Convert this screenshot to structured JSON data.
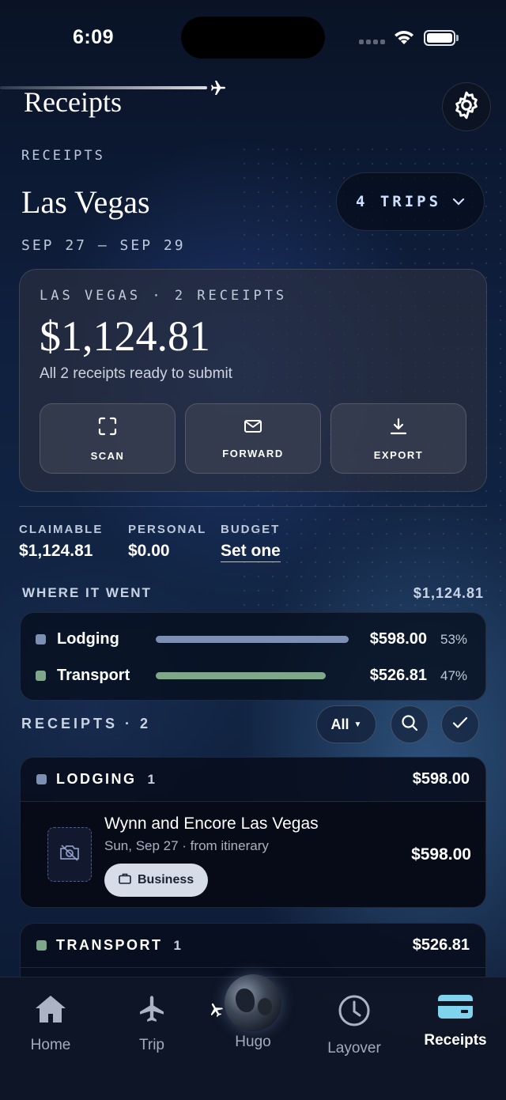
{
  "status_bar": {
    "time": "6:09"
  },
  "header": {
    "title": "Receipts"
  },
  "trip": {
    "section_label": "RECEIPTS",
    "name": "Las Vegas",
    "dates": "SEP 27 — SEP 29",
    "trips_selector": "4 TRIPS"
  },
  "summary": {
    "eyebrow": "LAS VEGAS · 2 RECEIPTS",
    "amount": "$1,124.81",
    "subtitle": "All 2 receipts ready to submit",
    "actions": [
      {
        "label": "SCAN",
        "icon": "scan-icon"
      },
      {
        "label": "FORWARD",
        "icon": "mail-icon"
      },
      {
        "label": "EXPORT",
        "icon": "download-icon"
      }
    ]
  },
  "stats": [
    {
      "label": "CLAIMABLE",
      "value": "$1,124.81"
    },
    {
      "label": "PERSONAL",
      "value": "$0.00"
    },
    {
      "label": "BUDGET",
      "value": "Set one"
    }
  ],
  "breakdown": {
    "label": "WHERE IT WENT",
    "total": "$1,124.81",
    "categories": [
      {
        "name": "Lodging",
        "amount": "$598.00",
        "percent_label": "53%",
        "share": 1.0,
        "color": "#7d8fb3"
      },
      {
        "name": "Transport",
        "amount": "$526.81",
        "percent_label": "47%",
        "share": 0.88,
        "color": "#7fa88a"
      }
    ]
  },
  "receipts_section": {
    "label": "RECEIPTS · 2",
    "filter": "All",
    "groups": [
      {
        "name": "LODGING",
        "count": "1",
        "total": "$598.00",
        "color": "#7d8fb3",
        "items": [
          {
            "title": "Wynn and Encore Las Vegas",
            "meta": "Sun, Sep 27 · from itinerary",
            "tag": "Business",
            "amount": "$598.00"
          }
        ]
      },
      {
        "name": "TRANSPORT",
        "count": "1",
        "total": "$526.81",
        "color": "#7fa88a"
      }
    ]
  },
  "tab_bar": {
    "tabs": [
      {
        "label": "Home",
        "icon": "home-icon"
      },
      {
        "label": "Trip",
        "icon": "airplane-icon"
      },
      {
        "label": "Hugo",
        "icon": "globe-icon"
      },
      {
        "label": "Layover",
        "icon": "clock-icon"
      },
      {
        "label": "Receipts",
        "icon": "card-icon",
        "active": true
      }
    ]
  }
}
